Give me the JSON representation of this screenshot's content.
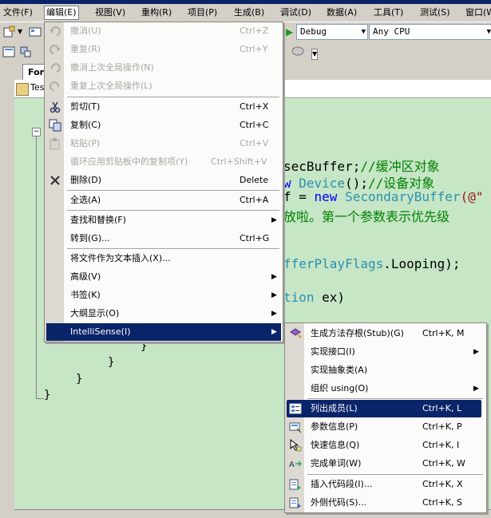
{
  "menubar": {
    "items": [
      {
        "label": "文件(F)"
      },
      {
        "label": "编辑(E)"
      },
      {
        "label": "视图(V)"
      },
      {
        "label": "重构(R)"
      },
      {
        "label": "项目(P)"
      },
      {
        "label": "生成(B)"
      },
      {
        "label": "调试(D)"
      },
      {
        "label": "数据(A)"
      },
      {
        "label": "工具(T)"
      },
      {
        "label": "测试(S)"
      },
      {
        "label": "窗口(W)"
      }
    ]
  },
  "toolbar": {
    "config": "Debug",
    "platform": "Any CPU"
  },
  "tabs": {
    "active": "Form"
  },
  "editor": {
    "file_combo": "Tes",
    "lines": [
      {
        "text": "secBuffer;",
        "comment": "//缓冲区对象"
      },
      {
        "kw": "w ",
        "type": "Device",
        "text": "();",
        "comment": "//设备对象"
      },
      {
        "text": "f = ",
        "kw": "new ",
        "type": "SecondaryBuffer",
        "text2": "(@\""
      },
      {
        "comment": "放啦。第一个参数表示优先级"
      },
      {
        "type": "fferPlayFlags",
        "text": ".Looping);"
      },
      {
        "type": "tion",
        "text": " ex)"
      }
    ],
    "closing_braces": [
      "}",
      "}",
      "}",
      "}"
    ]
  },
  "edit_menu": {
    "items": [
      {
        "label": "撤消(U)",
        "shortcut": "Ctrl+Z",
        "icon": "undo-icon"
      },
      {
        "label": "重复(R)",
        "shortcut": "Ctrl+Y",
        "icon": "redo-icon"
      },
      {
        "label": "撤消上次全局操作(N)",
        "shortcut": "",
        "icon": "undo-global-icon"
      },
      {
        "label": "重复上次全局操作(L)",
        "shortcut": "",
        "icon": "redo-global-icon"
      },
      {
        "label": "剪切(T)",
        "shortcut": "Ctrl+X",
        "icon": "cut-icon"
      },
      {
        "label": "复制(C)",
        "shortcut": "Ctrl+C",
        "icon": "copy-icon"
      },
      {
        "label": "粘贴(P)",
        "shortcut": "Ctrl+V",
        "icon": "paste-icon"
      },
      {
        "label": "循环应用剪贴板中的复制项(Y)",
        "shortcut": "Ctrl+Shift+V",
        "icon": ""
      },
      {
        "label": "删除(D)",
        "shortcut": "Delete",
        "icon": "delete-icon"
      },
      {
        "label": "全选(A)",
        "shortcut": "Ctrl+A",
        "icon": ""
      },
      {
        "label": "查找和替换(F)",
        "shortcut": "",
        "icon": ""
      },
      {
        "label": "转到(G)...",
        "shortcut": "Ctrl+G",
        "icon": ""
      },
      {
        "label": "将文件作为文本插入(X)...",
        "shortcut": "",
        "icon": ""
      },
      {
        "label": "高级(V)",
        "shortcut": "",
        "icon": ""
      },
      {
        "label": "书签(K)",
        "shortcut": "",
        "icon": ""
      },
      {
        "label": "大纲显示(O)",
        "shortcut": "",
        "icon": ""
      },
      {
        "label": "IntelliSense(I)",
        "shortcut": "",
        "icon": ""
      }
    ]
  },
  "intellisense_menu": {
    "items": [
      {
        "label": "生成方法存根(Stub)(G)",
        "shortcut": "Ctrl+K, M",
        "icon": "method-stub-icon"
      },
      {
        "label": "实现接口(I)",
        "shortcut": "",
        "icon": ""
      },
      {
        "label": "实现抽象类(A)",
        "shortcut": "",
        "icon": ""
      },
      {
        "label": "组织 using(O)",
        "shortcut": "",
        "icon": ""
      },
      {
        "label": "列出成员(L)",
        "shortcut": "Ctrl+K, L",
        "icon": "list-members-icon"
      },
      {
        "label": "参数信息(P)",
        "shortcut": "Ctrl+K, P",
        "icon": "parameter-info-icon"
      },
      {
        "label": "快速信息(Q)",
        "shortcut": "Ctrl+K, I",
        "icon": "quick-info-icon"
      },
      {
        "label": "完成单词(W)",
        "shortcut": "Ctrl+K, W",
        "icon": "complete-word-icon"
      },
      {
        "label": "插入代码段(I)...",
        "shortcut": "Ctrl+K, X",
        "icon": "insert-snippet-icon"
      },
      {
        "label": "外侧代码(S)...",
        "shortcut": "Ctrl+K, S",
        "icon": "surround-with-icon"
      }
    ]
  },
  "colors": {
    "editor_bg": "#c6e6c6",
    "highlight": "#0a246a",
    "keyword": "#0000ff",
    "type": "#2b91af",
    "comment": "#008000"
  }
}
